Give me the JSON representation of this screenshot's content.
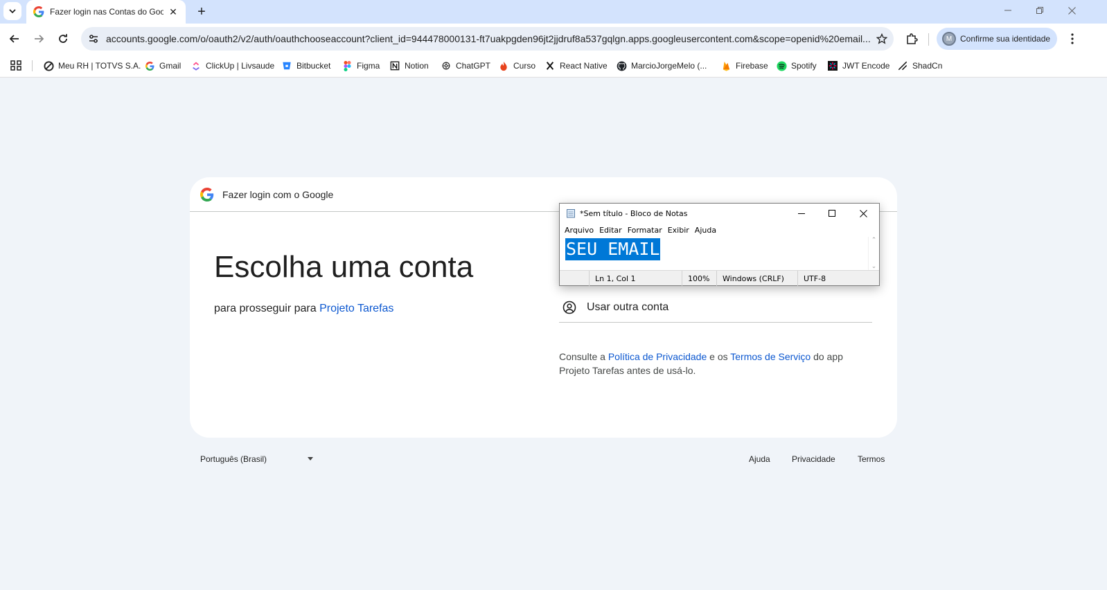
{
  "browser": {
    "tab": {
      "title": "Fazer login nas Contas do Goog"
    },
    "url": "accounts.google.com/o/oauth2/v2/auth/oauthchooseaccount?client_id=944478000131-ft7uakpgden96jt2jjdruf8a537gqlgn.apps.googleusercontent.com&scope=openid%20email...",
    "profile_chip": {
      "avatar_letter": "M",
      "label": "Confirme sua identidade"
    },
    "bookmarks": [
      {
        "label": "Meu RH | TOTVS S.A.",
        "icon": "totvs-icon"
      },
      {
        "label": "Gmail",
        "icon": "google-icon"
      },
      {
        "label": "ClickUp | Livsaude",
        "icon": "clickup-icon"
      },
      {
        "label": "Bitbucket",
        "icon": "bitbucket-icon"
      },
      {
        "label": "Figma",
        "icon": "figma-icon"
      },
      {
        "label": "Notion",
        "icon": "notion-icon"
      },
      {
        "label": "ChatGPT",
        "icon": "chatgpt-icon"
      },
      {
        "label": "Curso",
        "icon": "flame-icon"
      },
      {
        "label": "React Native",
        "icon": "x-icon"
      },
      {
        "label": "MarcioJorgeMelo (...",
        "icon": "github-icon"
      },
      {
        "label": "Firebase",
        "icon": "firebase-icon"
      },
      {
        "label": "Spotify",
        "icon": "spotify-icon"
      },
      {
        "label": "JWT Encode",
        "icon": "jwt-icon"
      },
      {
        "label": "ShadCn",
        "icon": "shadcn-icon"
      }
    ]
  },
  "signin": {
    "header": "Fazer login com o Google",
    "headline": "Escolha uma conta",
    "sub_prefix": "para prosseguir para ",
    "app_name": "Projeto Tarefas",
    "other_account": "Usar outra conta",
    "policy": {
      "p1": "Consulte a ",
      "privacy_link": "Política de Privacidade",
      "p2": " e os ",
      "terms_link": "Termos de Serviço",
      "p3": " do app Projeto Tarefas antes de usá-lo."
    },
    "footer": {
      "language": "Português (Brasil)",
      "help": "Ajuda",
      "privacy": "Privacidade",
      "terms": "Termos"
    }
  },
  "notepad": {
    "title": "*Sem título - Bloco de Notas",
    "menu": [
      "Arquivo",
      "Editar",
      "Formatar",
      "Exibir",
      "Ajuda"
    ],
    "content": "SEU EMAIL",
    "status": {
      "position": "Ln 1, Col 1",
      "zoom": "100%",
      "line_ending": "Windows (CRLF)",
      "encoding": "UTF-8"
    }
  },
  "colors": {
    "link": "#0b57d0",
    "tabstrip": "#d3e3fd",
    "page_bg": "#f0f4f9",
    "selection": "#0078d7"
  }
}
